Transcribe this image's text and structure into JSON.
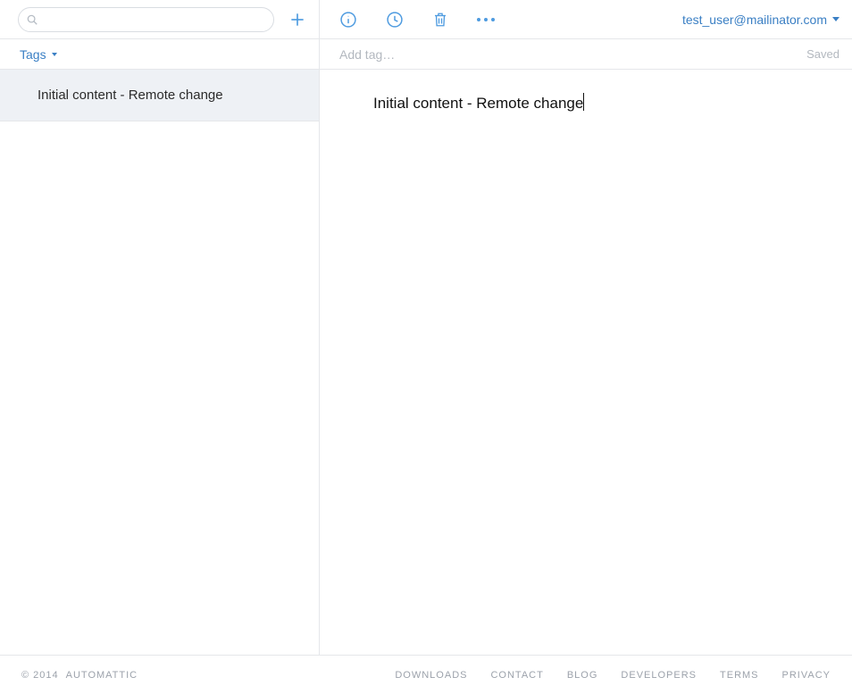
{
  "sidebar_header": {
    "search_placeholder": "",
    "tags_label": "Tags"
  },
  "toolbar": {},
  "user": {
    "email": "test_user@mailinator.com"
  },
  "tagbar": {
    "placeholder": "Add tag…",
    "status": "Saved"
  },
  "notes": [
    {
      "title": "Initial content - Remote change"
    }
  ],
  "editor": {
    "content": "Initial content - Remote change"
  },
  "footer": {
    "copyright_prefix": "© 2014",
    "company": "AUTOMATTIC",
    "links": [
      "DOWNLOADS",
      "CONTACT",
      "BLOG",
      "DEVELOPERS",
      "TERMS",
      "PRIVACY"
    ]
  }
}
